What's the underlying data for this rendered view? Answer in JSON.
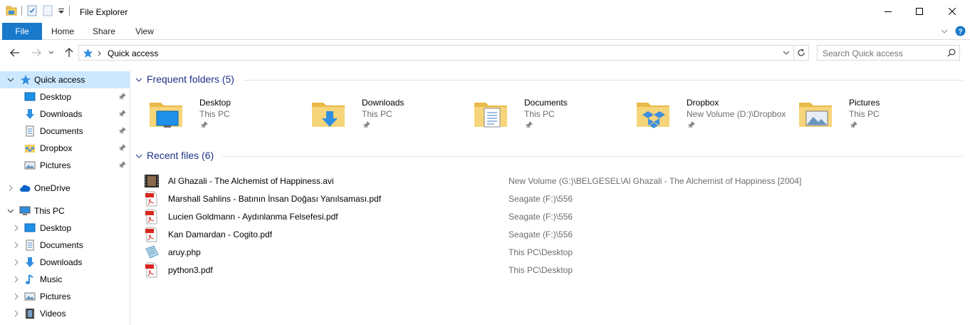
{
  "window": {
    "title": "File Explorer"
  },
  "ribbon": {
    "tabs": [
      "File",
      "Home",
      "Share",
      "View"
    ]
  },
  "address": {
    "crumb": "Quick access"
  },
  "search": {
    "placeholder": "Search Quick access"
  },
  "nav": {
    "quick_access": {
      "label": "Quick access",
      "items": [
        {
          "label": "Desktop",
          "icon": "desktop-icon"
        },
        {
          "label": "Downloads",
          "icon": "downloads-icon"
        },
        {
          "label": "Documents",
          "icon": "documents-icon"
        },
        {
          "label": "Dropbox",
          "icon": "dropbox-icon"
        },
        {
          "label": "Pictures",
          "icon": "pictures-icon"
        }
      ]
    },
    "onedrive": {
      "label": "OneDrive"
    },
    "this_pc": {
      "label": "This PC",
      "items": [
        {
          "label": "Desktop",
          "icon": "desktop-icon"
        },
        {
          "label": "Documents",
          "icon": "documents-icon"
        },
        {
          "label": "Downloads",
          "icon": "downloads-icon"
        },
        {
          "label": "Music",
          "icon": "music-icon"
        },
        {
          "label": "Pictures",
          "icon": "pictures-icon"
        },
        {
          "label": "Videos",
          "icon": "videos-icon"
        }
      ]
    }
  },
  "frequent": {
    "header": "Frequent folders (5)",
    "folders": [
      {
        "name": "Desktop",
        "location": "This PC",
        "icon": "desktop-folder-icon"
      },
      {
        "name": "Downloads",
        "location": "This PC",
        "icon": "downloads-folder-icon"
      },
      {
        "name": "Documents",
        "location": "This PC",
        "icon": "documents-folder-icon"
      },
      {
        "name": "Dropbox",
        "location": "New Volume (D:)\\Dropbox",
        "icon": "dropbox-folder-icon"
      },
      {
        "name": "Pictures",
        "location": "This PC",
        "icon": "pictures-folder-icon"
      }
    ]
  },
  "recent": {
    "header": "Recent files (6)",
    "files": [
      {
        "name": "Al Ghazali - The Alchemist of Happiness.avi",
        "location": "New Volume (G:)\\BELGESEL\\Al Ghazali - The Alchemist of Happiness [2004]",
        "icon": "video-file-icon"
      },
      {
        "name": "Marshall Sahlins - Batının İnsan Doğası Yanılsaması.pdf",
        "location": "Seagate (F:)\\556",
        "icon": "pdf-file-icon"
      },
      {
        "name": "Lucien Goldmann - Aydınlanma Felsefesi.pdf",
        "location": "Seagate (F:)\\556",
        "icon": "pdf-file-icon"
      },
      {
        "name": "Kan Damardan - Cogito.pdf",
        "location": "Seagate (F:)\\556",
        "icon": "pdf-file-icon"
      },
      {
        "name": "aruy.php",
        "location": "This PC\\Desktop",
        "icon": "php-file-icon"
      },
      {
        "name": "python3.pdf",
        "location": "This PC\\Desktop",
        "icon": "pdf-file-icon"
      }
    ]
  },
  "colors": {
    "accent": "#1979ca",
    "selection": "#cce8ff",
    "group_header": "#1e3287",
    "folder": "#f4cd63"
  }
}
